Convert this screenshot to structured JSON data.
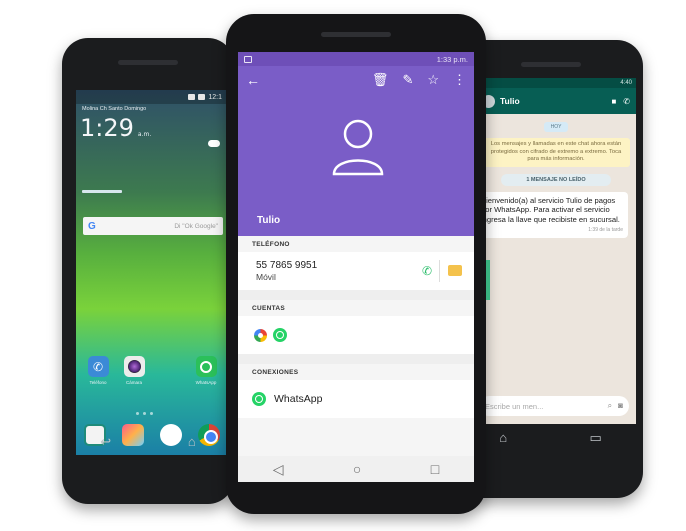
{
  "left_phone": {
    "status_text": "12:1",
    "carrier": "Molina Ch Santo Domingo",
    "clock_time": "1:29",
    "clock_date": "a.m.",
    "search_hint": "Di \"Ok Google\"",
    "apps": [
      {
        "label": "Teléfono"
      },
      {
        "label": "Cámara"
      },
      {
        "label": ""
      },
      {
        "label": "WhatsApp"
      }
    ]
  },
  "center_phone": {
    "status_right": "1:33 p.m.",
    "contact_name": "Tulio",
    "sections": {
      "phone": "TELÉFONO",
      "accounts": "CUENTAS",
      "connections": "CONEXIONES"
    },
    "phone_number": "55 7865 9951",
    "phone_type": "Móvil",
    "connection_app": "WhatsApp"
  },
  "right_phone": {
    "status_right": "4:40",
    "chat_name": "Tulio",
    "day_badge": "HOY",
    "encryption_notice": "Los mensajes y llamadas en este chat ahora están protegidos con cifrado de extremo a extremo. Toca para más información.",
    "unread_badge": "1 MENSAJE NO LEÍDO",
    "message_text": "Bienvenido(a) al servicio Tulio de pagos por WhatsApp. Para activar el servicio ingresa la llave que recibiste en sucursal.",
    "message_time": "1:39 de la tarde",
    "input_placeholder": "Escribe un men..."
  }
}
